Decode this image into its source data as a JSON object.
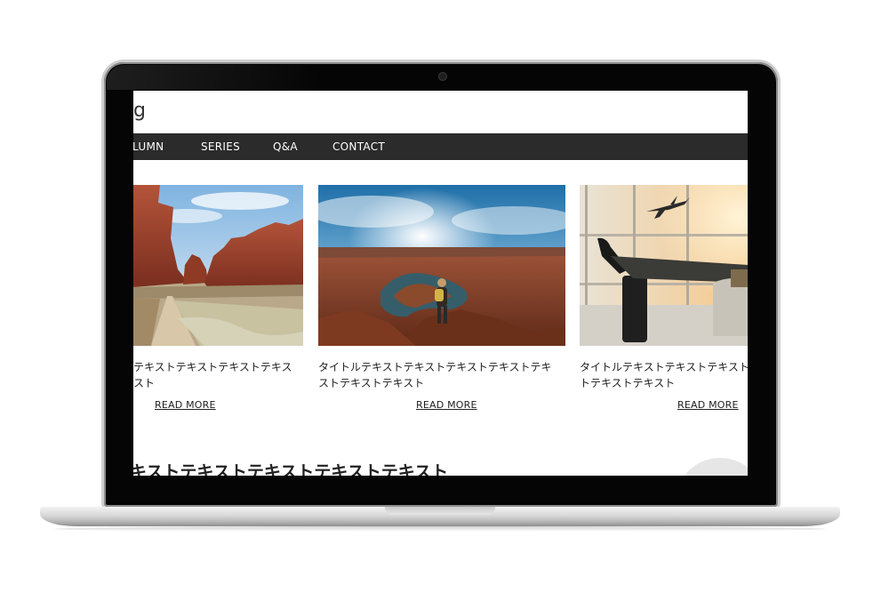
{
  "site": {
    "logo_text": "og"
  },
  "nav": {
    "items": [
      {
        "label": "LUMN"
      },
      {
        "label": "SERIES"
      },
      {
        "label": "Q&A"
      },
      {
        "label": "CONTACT"
      }
    ]
  },
  "cards": [
    {
      "title_line1": "テキストテキストテキストテキス",
      "title_line2": "スト",
      "read_more": "READ MORE"
    },
    {
      "title_line1": "タイトルテキストテキストテキストテキストテキ",
      "title_line2": "ストテキストテキスト",
      "read_more": "READ MORE"
    },
    {
      "title_line1": "タイトルテキストテキストテキストテキストテ",
      "title_line2": "トテキストテキスト",
      "read_more": "READ MORE"
    }
  ],
  "section": {
    "heading": "キストテキストテキストテキストテキスト"
  },
  "colors": {
    "nav_bg": "#2b2b2b",
    "text": "#222222",
    "bezel": "#050505"
  }
}
